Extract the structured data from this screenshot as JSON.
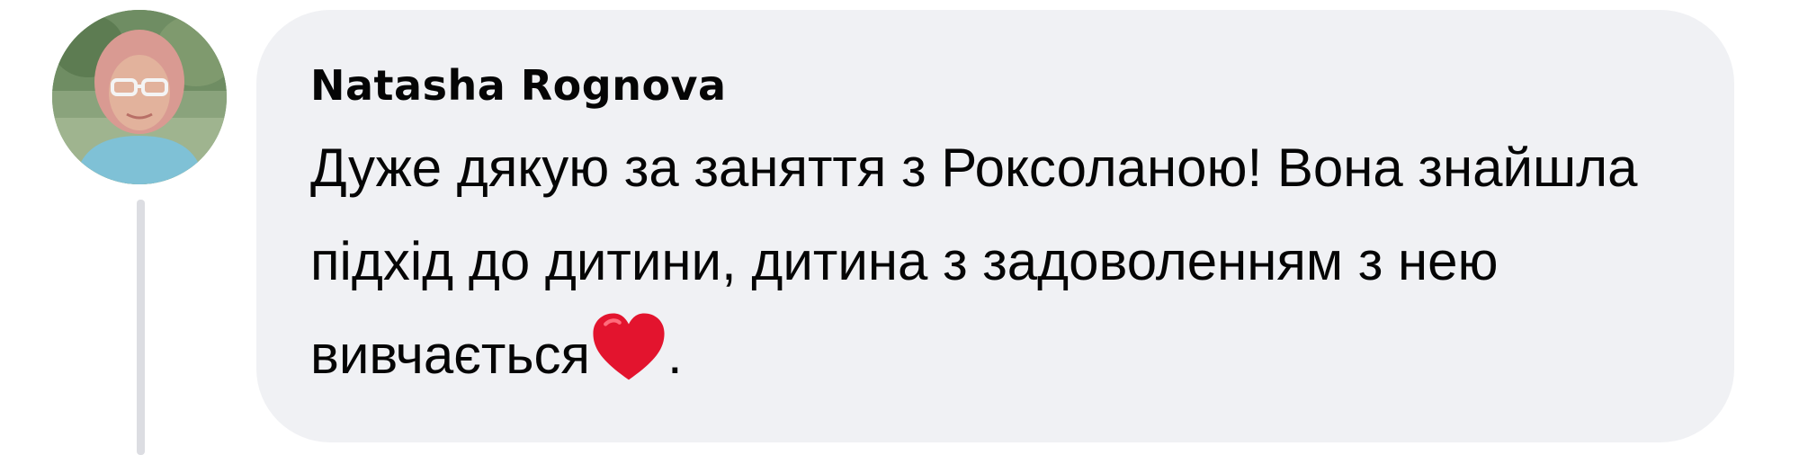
{
  "comment": {
    "author": "Natasha Rognova",
    "text": "Дуже дякую за заняття з Роксоланою! Вона знайшла підхід до дитини, дитина з задоволенням з нею вивчається",
    "text_after_emoji": ".",
    "emoji_icon": "red-heart-icon",
    "emoji_color": "#e3142e"
  },
  "colors": {
    "bubble_background": "#f0f1f4",
    "thread_line": "#dcdde2",
    "text": "#050505"
  }
}
